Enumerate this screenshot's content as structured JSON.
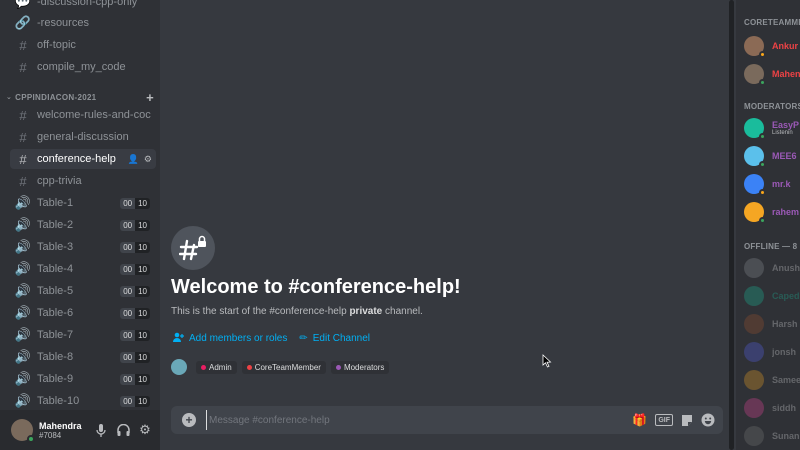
{
  "sidebar": {
    "channels_top": [
      {
        "name": "-discussion-cpp-only",
        "icon": "chat-bubbles-icon"
      },
      {
        "name": "-resources",
        "icon": "link-icon"
      },
      {
        "name": "off-topic",
        "icon": "hash-icon"
      },
      {
        "name": "compile_my_code",
        "icon": "hash-icon"
      }
    ],
    "category": {
      "label": "CPPINDIACON-2021"
    },
    "channels": [
      {
        "name": "welcome-rules-and-coc",
        "icon": "hash-icon"
      },
      {
        "name": "general-discussion",
        "icon": "hash-icon"
      },
      {
        "name": "conference-help",
        "icon": "hash-icon",
        "active": true
      },
      {
        "name": "cpp-trivia",
        "icon": "hash-icon"
      }
    ],
    "voice_channels": [
      {
        "name": "Table-1",
        "count_a": "00",
        "count_b": "10"
      },
      {
        "name": "Table-2",
        "count_a": "00",
        "count_b": "10"
      },
      {
        "name": "Table-3",
        "count_a": "00",
        "count_b": "10"
      },
      {
        "name": "Table-4",
        "count_a": "00",
        "count_b": "10"
      },
      {
        "name": "Table-5",
        "count_a": "00",
        "count_b": "10"
      },
      {
        "name": "Table-6",
        "count_a": "00",
        "count_b": "10"
      },
      {
        "name": "Table-7",
        "count_a": "00",
        "count_b": "10"
      },
      {
        "name": "Table-8",
        "count_a": "00",
        "count_b": "10"
      },
      {
        "name": "Table-9",
        "count_a": "00",
        "count_b": "10"
      },
      {
        "name": "Table-10",
        "count_a": "00",
        "count_b": "10"
      }
    ]
  },
  "user": {
    "name": "Mahendra",
    "tag": "#7084",
    "status_color": "#3ba55d"
  },
  "welcome": {
    "title": "Welcome to #conference-help!",
    "sub_prefix": "This is the start of the #conference-help ",
    "sub_bold": "private",
    "sub_suffix": " channel.",
    "add_members": "Add members or roles",
    "edit_channel": "Edit Channel"
  },
  "roles": [
    {
      "name": "Admin",
      "color": "#e91e63"
    },
    {
      "name": "CoreTeamMember",
      "color": "#ed4245"
    },
    {
      "name": "Moderators",
      "color": "#9b59b6"
    }
  ],
  "composer": {
    "placeholder": "Message #conference-help"
  },
  "members": {
    "coreteam": {
      "header": "CORETEAMME",
      "items": [
        {
          "name": "Ankur",
          "color": "#ed4245",
          "avatar": "#8b6a55",
          "status": "#faa61a"
        },
        {
          "name": "Mahen",
          "color": "#ed4245",
          "avatar": "#7a6a5c",
          "status": "#3ba55d"
        }
      ]
    },
    "moderators": {
      "header": "MODERATORS",
      "items": [
        {
          "name": "EasyP",
          "sub": "Listenin",
          "color": "#9b59b6",
          "avatar": "#1abc9c",
          "status": "#3ba55d"
        },
        {
          "name": "MEE6",
          "color": "#9b59b6",
          "avatar": "#5bc0eb",
          "status": "#3ba55d"
        },
        {
          "name": "mr.k",
          "color": "#9b59b6",
          "avatar": "#3b82f6",
          "status": "#faa61a"
        },
        {
          "name": "rahem",
          "color": "#9b59b6",
          "avatar": "#f5a623",
          "status": "#3ba55d"
        }
      ]
    },
    "offline": {
      "header": "OFFLINE — 8",
      "items": [
        {
          "name": "Anush",
          "color": "#dcddde",
          "avatar": "#8e9297"
        },
        {
          "name": "Caped",
          "color": "#1abc9c",
          "avatar": "#1abc9c"
        },
        {
          "name": "Harsh",
          "color": "#dcddde",
          "avatar": "#a0522d"
        },
        {
          "name": "jonsh",
          "color": "#dcddde",
          "avatar": "#5865f2"
        },
        {
          "name": "Samee",
          "color": "#dcddde",
          "avatar": "#f5a623"
        },
        {
          "name": "siddh",
          "color": "#dcddde",
          "avatar": "#eb459e"
        },
        {
          "name": "Sunan",
          "color": "#dcddde",
          "avatar": "#7a7a7a"
        }
      ]
    }
  },
  "colors": {
    "accent": "#00b0f4",
    "sidebar_bg": "#2f3136",
    "main_bg": "#36393f"
  }
}
